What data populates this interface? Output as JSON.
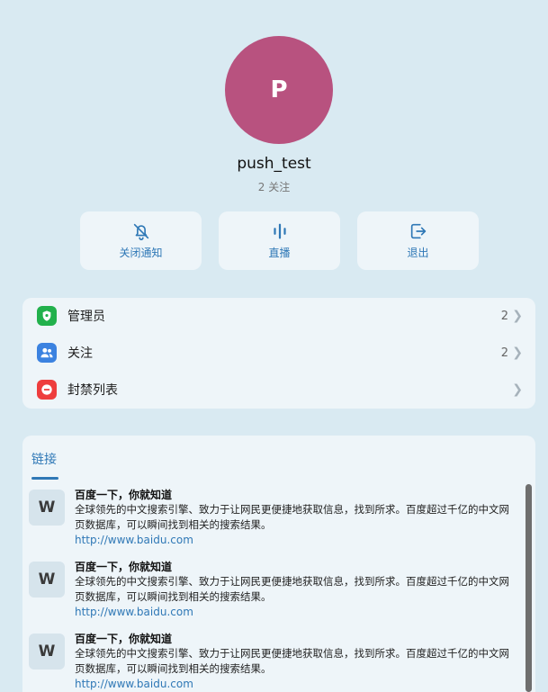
{
  "profile": {
    "initial": "P",
    "name": "push_test",
    "subtitle": "2 关注",
    "avatar_color": "#b8527f"
  },
  "actions": [
    {
      "label": "关闭通知",
      "icon": "bell-off-icon"
    },
    {
      "label": "直播",
      "icon": "live-audio-icon"
    },
    {
      "label": "退出",
      "icon": "exit-icon"
    }
  ],
  "menu": [
    {
      "label": "管理员",
      "count": "2",
      "icon": "admin-shield-icon",
      "color": "#22b14c"
    },
    {
      "label": "关注",
      "count": "2",
      "icon": "users-icon",
      "color": "#3b82e0"
    },
    {
      "label": "封禁列表",
      "count": "",
      "icon": "ban-icon",
      "color": "#ee3d3d"
    }
  ],
  "links": {
    "tab_label": "链接",
    "items": [
      {
        "thumb": "W",
        "title": "百度一下，你就知道",
        "desc": "全球领先的中文搜索引擎、致力于让网民更便捷地获取信息，找到所求。百度超过千亿的中文网页数据库，可以瞬间找到相关的搜索结果。",
        "url": "http://www.baidu.com"
      },
      {
        "thumb": "W",
        "title": "百度一下，你就知道",
        "desc": "全球领先的中文搜索引擎、致力于让网民更便捷地获取信息，找到所求。百度超过千亿的中文网页数据库，可以瞬间找到相关的搜索结果。",
        "url": "http://www.baidu.com"
      },
      {
        "thumb": "W",
        "title": "百度一下，你就知道",
        "desc": "全球领先的中文搜索引擎、致力于让网民更便捷地获取信息，找到所求。百度超过千亿的中文网页数据库，可以瞬间找到相关的搜索结果。",
        "url": "http://www.baidu.com"
      }
    ]
  },
  "colors": {
    "background": "#d9eaf2",
    "card": "#eef5f9",
    "accent": "#2f78b6"
  }
}
